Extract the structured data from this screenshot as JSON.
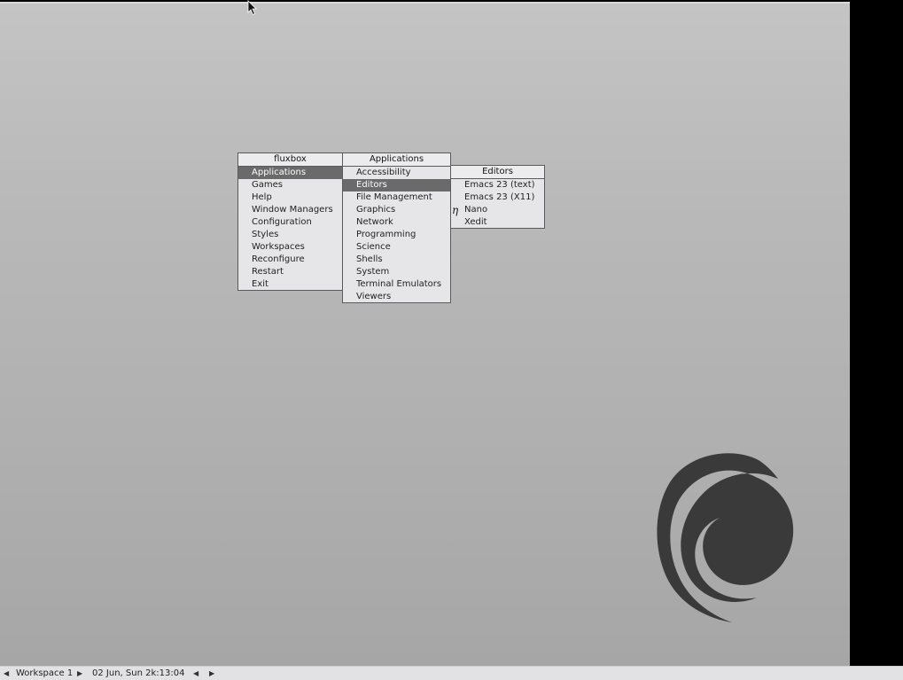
{
  "root_menu": {
    "title": "fluxbox",
    "items": [
      "Applications",
      "Games",
      "Help",
      "Window Managers",
      "Configuration",
      "Styles",
      "Workspaces",
      "Reconfigure",
      "Restart",
      "Exit"
    ]
  },
  "applications_menu": {
    "title": "Applications",
    "items": [
      "Accessibility",
      "Editors",
      "File Management",
      "Graphics",
      "Network",
      "Programming",
      "Science",
      "Shells",
      "System",
      "Terminal Emulators",
      "Viewers"
    ]
  },
  "editors_menu": {
    "title": "Editors",
    "items": [
      "Emacs 23 (text)",
      "Emacs 23 (X11)",
      "Nano",
      "Xedit"
    ],
    "nano_icon": "η"
  },
  "toolbar": {
    "workspace_name": "Workspace 1",
    "clock": "02 Jun, Sun 2k:13:04"
  },
  "colors": {
    "menu_highlight": "#6a6a6a",
    "menu_bg": "#e6e6e8",
    "desktop_bg": "#b9b9b9"
  }
}
